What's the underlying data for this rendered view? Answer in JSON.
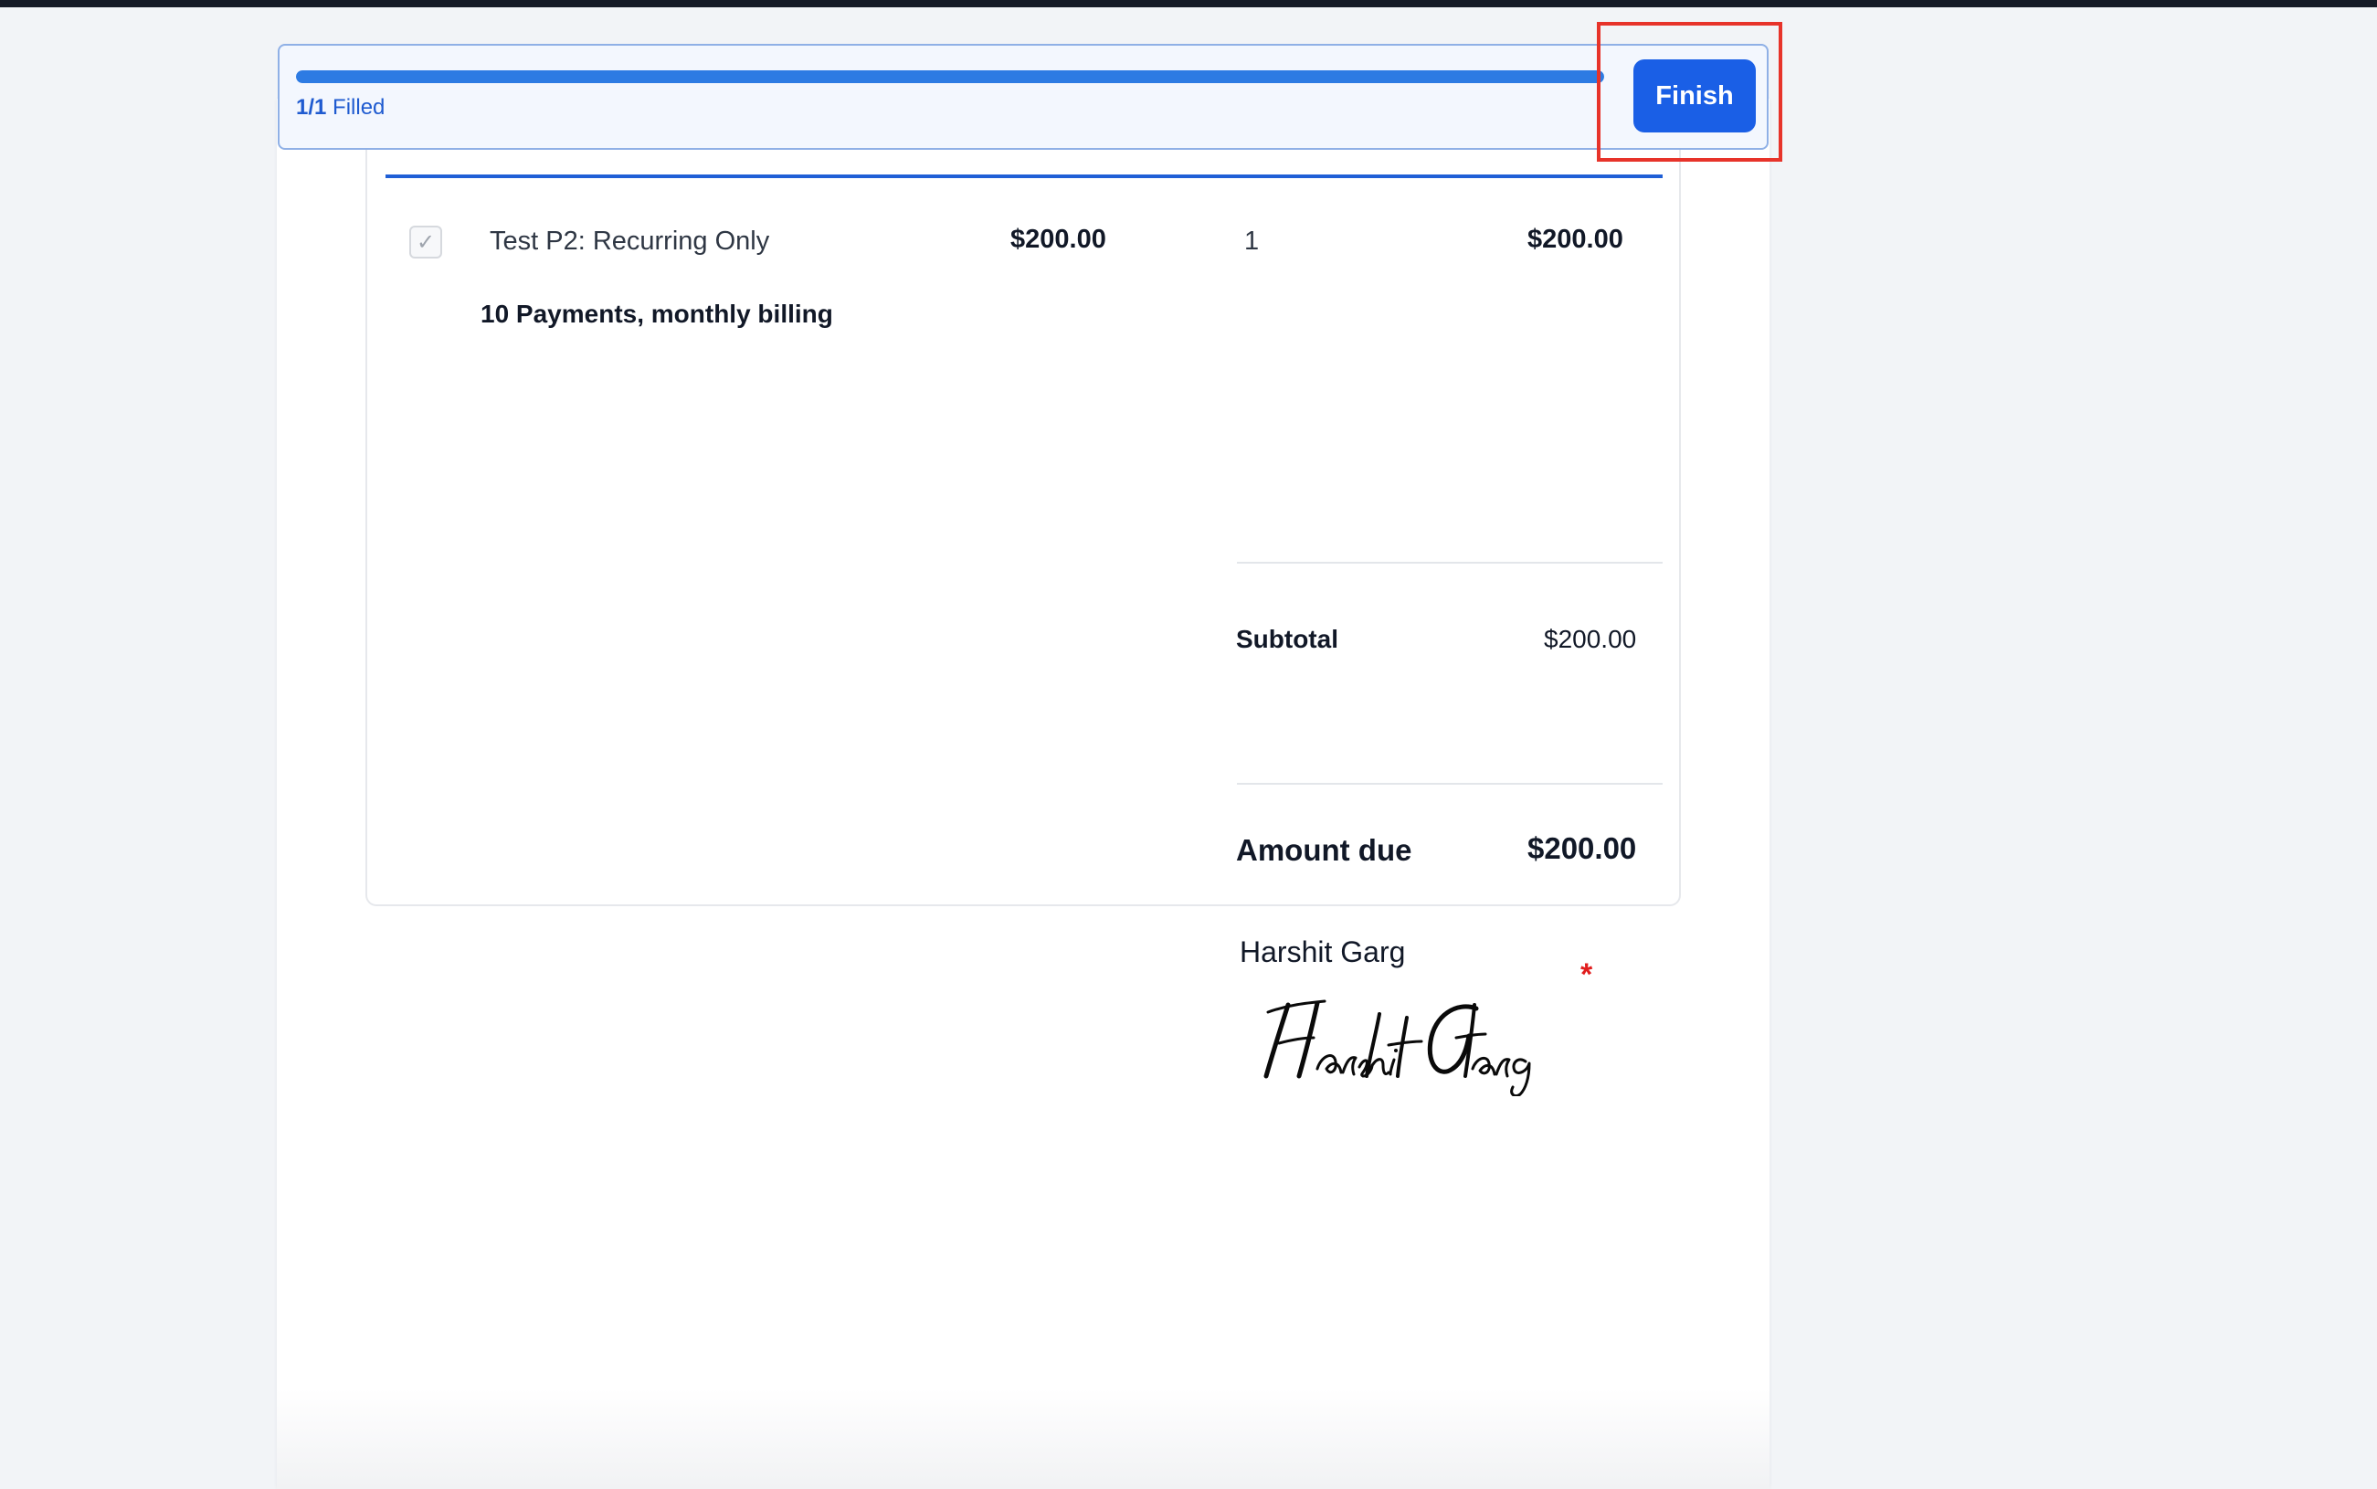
{
  "progress": {
    "filled_count": "1/1",
    "filled_label": "Filled",
    "fraction": 1.0,
    "finish_label": "Finish"
  },
  "line_item": {
    "name": "Test P2: Recurring Only",
    "price": "$200.00",
    "quantity": "1",
    "total": "$200.00",
    "description": "10 Payments, monthly billing",
    "checked": true
  },
  "summary": {
    "subtotal_label": "Subtotal",
    "subtotal_value": "$200.00",
    "amount_due_label": "Amount due",
    "amount_due_value": "$200.00"
  },
  "signature": {
    "signer_name": "Harshit Garg",
    "signature_text": "Harshit Garg",
    "required_mark": "*"
  },
  "colors": {
    "accent": "#1a5fe6",
    "progress_fill": "#2d7be3",
    "highlight": "#e7332a",
    "required": "#e11d1d"
  },
  "icons": {
    "checkbox": "check-icon"
  }
}
